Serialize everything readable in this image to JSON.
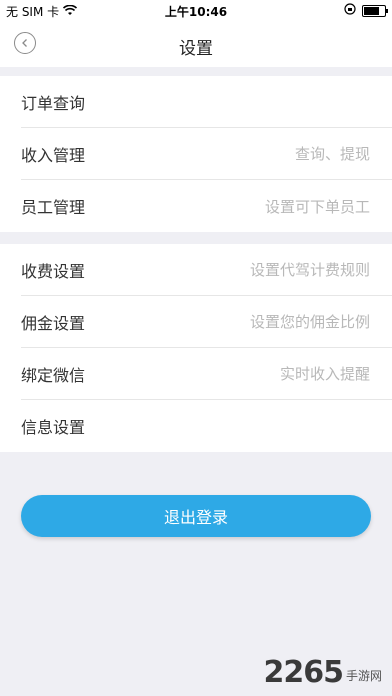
{
  "status": {
    "carrier": "无 SIM 卡",
    "time": "上午10:46",
    "wifi_icon": "wifi-icon",
    "battery_level": 0.85
  },
  "nav": {
    "title": "设置"
  },
  "section1": {
    "rows": [
      {
        "label": "订单查询",
        "hint": ""
      },
      {
        "label": "收入管理",
        "hint": "查询、提现"
      },
      {
        "label": "员工管理",
        "hint": "设置可下单员工"
      }
    ]
  },
  "section2": {
    "rows": [
      {
        "label": "收费设置",
        "hint": "设置代驾计费规则"
      },
      {
        "label": "佣金设置",
        "hint": "设置您的佣金比例"
      },
      {
        "label": "绑定微信",
        "hint": "实时收入提醒"
      },
      {
        "label": "信息设置",
        "hint": ""
      }
    ]
  },
  "logout": {
    "label": "退出登录"
  },
  "watermark": {
    "number": "2265",
    "text": "手游网"
  },
  "colors": {
    "accent": "#2ea9e6",
    "background": "#efeff4"
  }
}
